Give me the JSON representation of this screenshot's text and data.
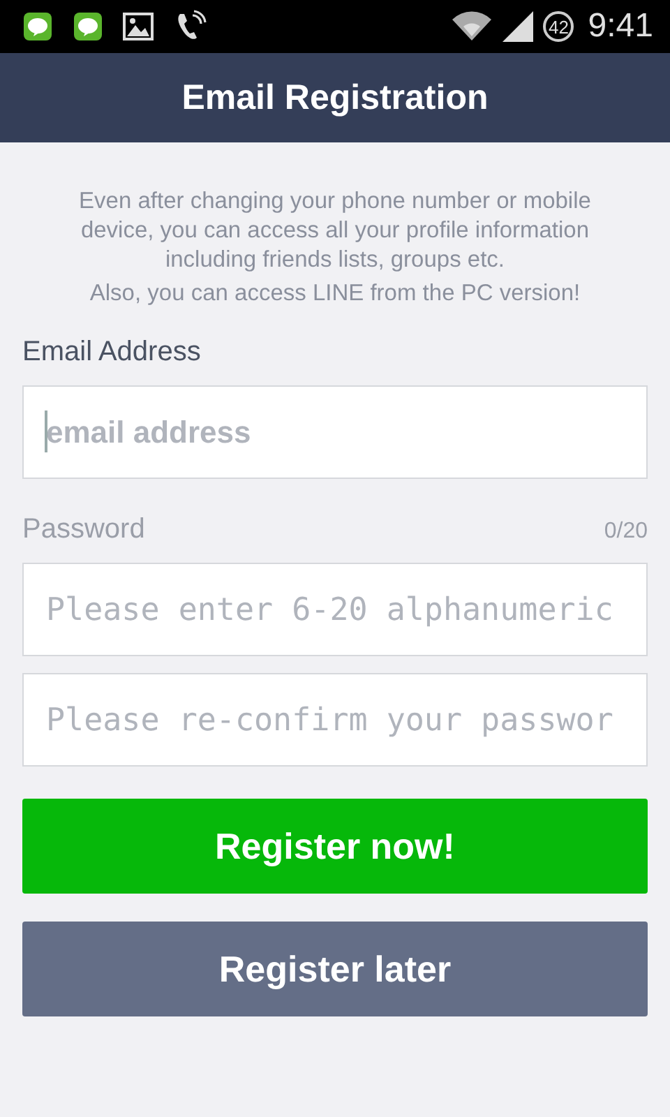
{
  "status_bar": {
    "battery": "42",
    "time": "9:41"
  },
  "header": {
    "title": "Email Registration"
  },
  "intro": [
    "Even after changing your phone number or mobile device, you can access all your profile information including friends lists, groups etc.",
    "Also, you can access LINE from the PC version!"
  ],
  "email": {
    "label": "Email Address",
    "field": {
      "placeholder": "email address",
      "focused": true
    }
  },
  "password": {
    "label": "Password",
    "counter": "0/20",
    "fields": [
      {
        "placeholder": "Please enter 6-20 alphanumeric"
      },
      {
        "placeholder": "Please re-confirm your passwor"
      }
    ]
  },
  "buttons": [
    {
      "label": "Register now!",
      "kind": "primary"
    },
    {
      "label": "Register later",
      "kind": "secondary"
    }
  ]
}
